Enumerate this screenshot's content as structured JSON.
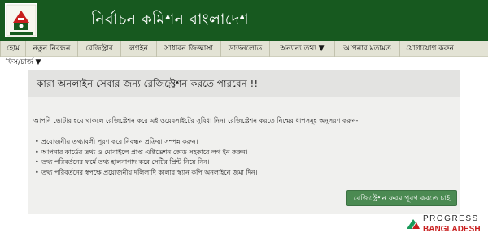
{
  "header": {
    "site_title": "নির্বাচন কমিশন বাংলাদেশ",
    "logo_icon": "election-commission-emblem-icon",
    "background_color": "#17591f"
  },
  "nav": {
    "items": [
      {
        "label": "হোম"
      },
      {
        "label": "নতুন নিবন্ধন"
      },
      {
        "label": "রেজিস্ট্রার"
      },
      {
        "label": "লগইন"
      },
      {
        "label": "সাধারন জিজ্ঞাসা"
      },
      {
        "label": "ডাউনলোড"
      },
      {
        "label": "অন্যান্য তথ্য ▼",
        "has_dropdown": true
      },
      {
        "label": "আপনার মতামত"
      },
      {
        "label": "যোগাযোগ করুন"
      }
    ],
    "secondary": {
      "label": "ফিস/চার্জ ▼",
      "has_dropdown": true
    }
  },
  "main": {
    "title": "কারা অনলাইন সেবার জন্য রেজিস্ট্রেশন করতে পারবেন !!",
    "intro": "আপনি ভোটার হয়ে থাকলে রেজিস্ট্রেশন করে এই ওয়েবসাইটের সুবিধা নিন। রেজিস্ট্রেশন করতে নিম্মের ধাপসমূহ অনুসরণ করুন-",
    "steps": [
      "প্রয়োজনীয় তথ্যাবলী পূরণ করে নিবন্ধন প্রক্রিয়া সম্পন্ন করুন।",
      "আপনার কার্ডের তথ্য ও মোবাইলে প্রাপ্ত এক্টিভেশন কোড সহকারে লগ ইন করুন।",
      "তথ্য পরিবর্তনের ফর্মে তথ্য হালনাগাদ করে সেটির প্রিন্ট নিয়ে নিন।",
      "তথ্য পরিবর্তনের স্বপক্ষে প্রয়োজনীয় দলিলাদি কালার স্ক্যান কপি অনলাইনে জমা দিন।"
    ],
    "cta_label": "রেজিস্ট্রেশন ফরম পূরণ করতে চাই",
    "cta_color": "#4b8a52"
  },
  "watermark": {
    "line1": "PROGRESS",
    "line2": "BANGLADESH",
    "accent_color": "#c81e1e"
  }
}
